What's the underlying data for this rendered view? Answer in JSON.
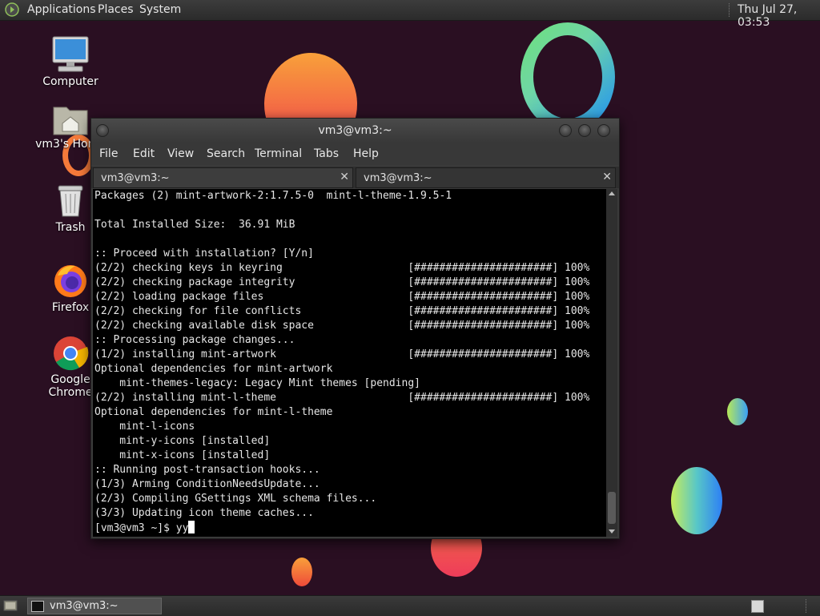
{
  "top_panel": {
    "menus": [
      "Applications",
      "Places",
      "System"
    ],
    "clock": "Thu Jul 27, 03:53"
  },
  "desktop": {
    "icons": [
      {
        "label": "Computer",
        "icon": "computer-icon"
      },
      {
        "label": "vm3's Home",
        "icon": "home-folder-icon"
      },
      {
        "label": "Trash",
        "icon": "trash-icon"
      },
      {
        "label": "Firefox",
        "icon": "firefox-icon"
      },
      {
        "label": "Google Chrome",
        "icon": "chrome-icon"
      }
    ]
  },
  "terminal": {
    "title": "vm3@vm3:~",
    "menu": [
      "File",
      "Edit",
      "View",
      "Search",
      "Terminal",
      "Tabs",
      "Help"
    ],
    "tabs": [
      {
        "label": "vm3@vm3:~",
        "active": true
      },
      {
        "label": "vm3@vm3:~",
        "active": false
      }
    ],
    "lines": [
      "Packages (2) mint-artwork-2:1.7.5-0  mint-l-theme-1.9.5-1",
      "",
      "Total Installed Size:  36.91 MiB",
      "",
      ":: Proceed with installation? [Y/n]",
      "(2/2) checking keys in keyring                    [######################] 100%",
      "(2/2) checking package integrity                  [######################] 100%",
      "(2/2) loading package files                       [######################] 100%",
      "(2/2) checking for file conflicts                 [######################] 100%",
      "(2/2) checking available disk space               [######################] 100%",
      ":: Processing package changes...",
      "(1/2) installing mint-artwork                     [######################] 100%",
      "Optional dependencies for mint-artwork",
      "    mint-themes-legacy: Legacy Mint themes [pending]",
      "(2/2) installing mint-l-theme                     [######################] 100%",
      "Optional dependencies for mint-l-theme",
      "    mint-l-icons",
      "    mint-y-icons [installed]",
      "    mint-x-icons [installed]",
      ":: Running post-transaction hooks...",
      "(1/3) Arming ConditionNeedsUpdate...",
      "(2/3) Compiling GSettings XML schema files...",
      "(3/3) Updating icon theme caches..."
    ],
    "prompt": "[vm3@vm3 ~]$ yy"
  },
  "bottom_panel": {
    "task": "vm3@vm3:~"
  },
  "colors": {
    "desktop_bg": "#2a0f22",
    "terminal_bg": "#000000",
    "terminal_fg": "#e6e6e6"
  }
}
